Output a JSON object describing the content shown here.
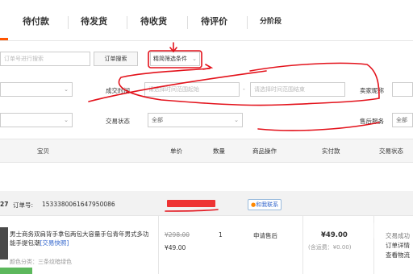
{
  "tabs": [
    {
      "label": "待付款"
    },
    {
      "label": "待发货"
    },
    {
      "label": "待收货"
    },
    {
      "label": "待评价"
    },
    {
      "label": "分阶段"
    }
  ],
  "search": {
    "placeholder": "订单号进行搜索",
    "button": "订单搜索",
    "advanced": "精简筛选条件"
  },
  "filters": {
    "time_label": "成交时间",
    "time_start_placeholder": "请选择时间范围起始",
    "time_end_placeholder": "请选择时间范围结束",
    "dash": "-",
    "seller_label": "卖家昵称",
    "status_label": "交易状态",
    "status_value": "全部",
    "service_label": "售后服务",
    "service_value": "全部"
  },
  "table_headers": [
    "宝贝",
    "单价",
    "数量",
    "商品操作",
    "实付款",
    "交易状态"
  ],
  "order": {
    "date_fragment": "27",
    "number_label": "订单号:",
    "number": "1533380061647950086",
    "contact": "和我联系",
    "title": "男士商务双肩背手拿包两包大容量手包青年男式多功能手提包潮",
    "tag": "[交易快照]",
    "spec": "颜色分类：三条纹暗绿色",
    "original_price": "¥298.00",
    "price": "¥49.00",
    "qty": "1",
    "after_sale": "申请售后",
    "paid": "¥49.00",
    "paid_note": "(含运费：¥0.00)",
    "status1": "交易成功",
    "status2": "订单详情",
    "status3": "查看物流"
  }
}
